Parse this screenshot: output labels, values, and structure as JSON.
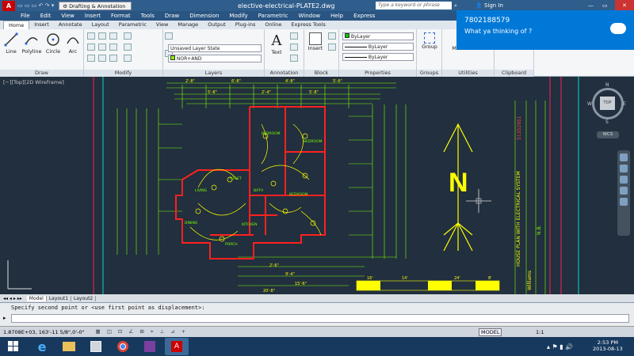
{
  "title_bar": {
    "workspace": "Drafting & Annotation",
    "doc_title": "elective-electrical-PLATE2.dwg",
    "search_placeholder": "Type a keyword or phrase",
    "signin": "Sign In"
  },
  "menu": [
    "File",
    "Edit",
    "View",
    "Insert",
    "Format",
    "Tools",
    "Draw",
    "Dimension",
    "Modify",
    "Parametric",
    "Window",
    "Help",
    "Express"
  ],
  "ribbon_tabs": [
    "Home",
    "Insert",
    "Annotate",
    "Layout",
    "Parametric",
    "View",
    "Manage",
    "Output",
    "Plug-ins",
    "Online",
    "Express Tools"
  ],
  "ribbon": {
    "draw_tools": [
      "Line",
      "Polyline",
      "Circle",
      "Arc"
    ],
    "panel_draw": "Draw",
    "panel_modify": "Modify",
    "layer_state": "Unsaved Layer State",
    "layer_current": "NOR+AND",
    "panel_layers": "Layers",
    "text": "Text",
    "panel_annotation": "Annotation",
    "insert": "Insert",
    "panel_block": "Block",
    "bylayer_color": "ByLayer",
    "bylayer_linetype": "ByLayer",
    "bylayer_lineweight": "ByLayer",
    "panel_properties": "Properties",
    "group": "Group",
    "panel_groups": "Groups",
    "measure": "Measure",
    "panel_utilities": "Utilities",
    "paste": "Paste",
    "panel_clipboard": "Clipboard"
  },
  "notification": {
    "number": "7802188579",
    "message": "What ya thinking of ?"
  },
  "viewport_label": "[−][Top][2D Wireframe]",
  "viewcube": {
    "n": "N",
    "s": "S",
    "e": "E",
    "w": "W",
    "top": "TOP",
    "wcs": "WCS"
  },
  "drawing": {
    "north_letter": "N",
    "rooms": [
      "LIVING",
      "BEDROOM",
      "BEDROOM",
      "TOILET",
      "BATH",
      "BEDROOM",
      "KITCHEN",
      "DINING",
      "PORCH"
    ],
    "title_block": [
      "HOUSE PLAN WITH ELECTRICAL SYSTEM",
      "Williams",
      "N.B.",
      "51352951"
    ],
    "scale_labels": [
      "16'",
      "14'",
      "24'",
      "8'"
    ],
    "dims_top": [
      "2'-8\"",
      "5'-8\"",
      "6'-8\"",
      "2'-4\"",
      "4'-8\"",
      "5'-8\"",
      "5'-6\""
    ],
    "dims_bottom": [
      "2'-6\"",
      "9'-4\"",
      "15'-6\"",
      "20'-8\""
    ]
  },
  "layout_tabs": [
    "Model",
    "Layout1",
    "Layout2"
  ],
  "command": {
    "history": "Specify second point or <use first point as displacement>:",
    "input": ""
  },
  "status": {
    "coords": "1.8708E+03,  163'-11 5/8\",0'-0\"",
    "model": "MODEL",
    "scale": "1:1"
  },
  "clock": {
    "time": "2:53 PM",
    "date": "2013-08-13"
  },
  "colors": {
    "accent": "#0078d7",
    "drawing_bg": "#212f3e",
    "wall": "#ff2020",
    "dims": "#7fff00",
    "symbols": "#ffff00"
  }
}
